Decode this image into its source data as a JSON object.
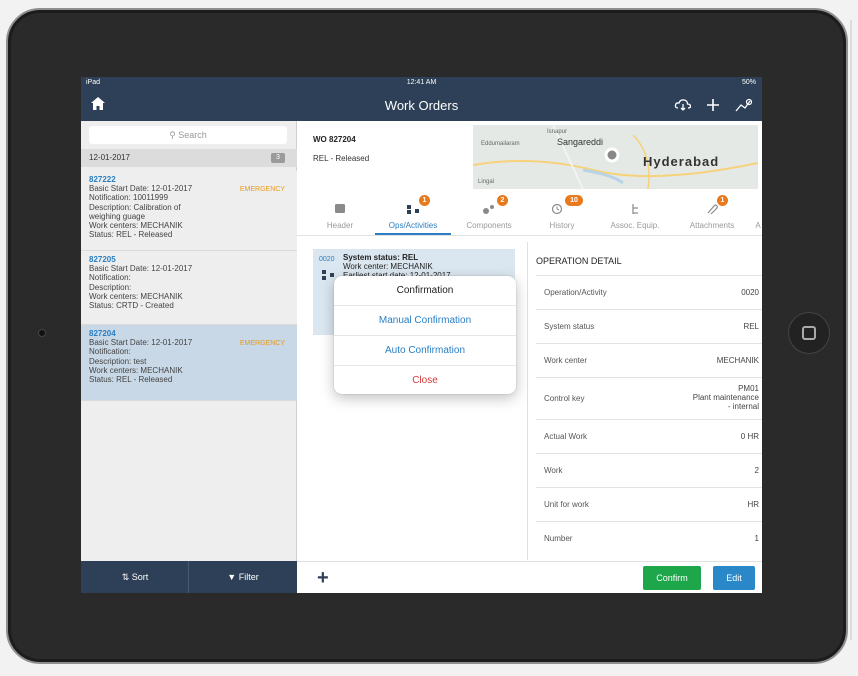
{
  "statusbar": {
    "device": "iPad",
    "time": "12:41 AM",
    "battery": "50%"
  },
  "navbar": {
    "title": "Work Orders"
  },
  "left": {
    "search_placeholder": "Search",
    "date_header": "12-01-2017",
    "date_count": "3",
    "items": [
      {
        "id": "827222",
        "lines": [
          "Basic Start Date: 12-01-2017",
          "Notification: 10011999",
          "Description: Calibration of",
          "weighing guage",
          "Work centers: MECHANIK",
          "Status: REL - Released"
        ],
        "tag": "EMERGENCY"
      },
      {
        "id": "827205",
        "lines": [
          "Basic Start Date: 12-01-2017",
          "Notification:",
          "Description:",
          "Work centers: MECHANIK",
          "Status: CRTD - Created"
        ],
        "tag": ""
      },
      {
        "id": "827204",
        "lines": [
          "Basic Start Date: 12-01-2017",
          "Notification:",
          "Description: test",
          "Work centers: MECHANIK",
          "Status: REL - Released"
        ],
        "tag": "EMERGENCY"
      }
    ],
    "sort_label": "Sort",
    "filter_label": "Filter"
  },
  "detail_header": {
    "wo": "WO 827204",
    "status": "REL - Released",
    "map_labels": {
      "sangareddi": "Sangareddi",
      "hyderabad": "Hyderabad",
      "eddumailaram": "Eddumailaram",
      "isnapur": "Isnapur",
      "lingampally": "Lingal"
    }
  },
  "tabs": [
    {
      "label": "Header",
      "badge": ""
    },
    {
      "label": "Ops/Activities",
      "badge": "1"
    },
    {
      "label": "Components",
      "badge": "2"
    },
    {
      "label": "History",
      "badge": "10"
    },
    {
      "label": "Assoc. Equip.",
      "badge": ""
    },
    {
      "label": "Attachments",
      "badge": "1"
    },
    {
      "label": "A",
      "badge": ""
    }
  ],
  "op_card": {
    "number": "0020",
    "line1": "System status: REL",
    "line2": "Work center: MECHANIK",
    "line3": "Earliest start date: 12-01-2017"
  },
  "operation_detail": {
    "title": "OPERATION DETAIL",
    "rows": [
      {
        "key": "Operation/Activity",
        "value": "0020"
      },
      {
        "key": "System status",
        "value": "REL"
      },
      {
        "key": "Work center",
        "value": "MECHANIK"
      },
      {
        "key": "Control key",
        "value": "PM01\nPlant maintenance\n- internal"
      },
      {
        "key": "Actual Work",
        "value": "0 HR"
      },
      {
        "key": "Work",
        "value": "2"
      },
      {
        "key": "Unit for work",
        "value": "HR"
      },
      {
        "key": "Number",
        "value": "1"
      }
    ]
  },
  "footer": {
    "confirm_label": "Confirm",
    "edit_label": "Edit"
  },
  "dialog": {
    "title": "Confirmation",
    "manual": "Manual Confirmation",
    "auto": "Auto Confirmation",
    "close": "Close"
  },
  "colors": {
    "navbar": "#2d4057",
    "accent": "#2a7fc4",
    "confirm": "#1ea64a",
    "edit": "#2a87c8",
    "close": "#d33a3a",
    "badge": "#e8791c"
  }
}
